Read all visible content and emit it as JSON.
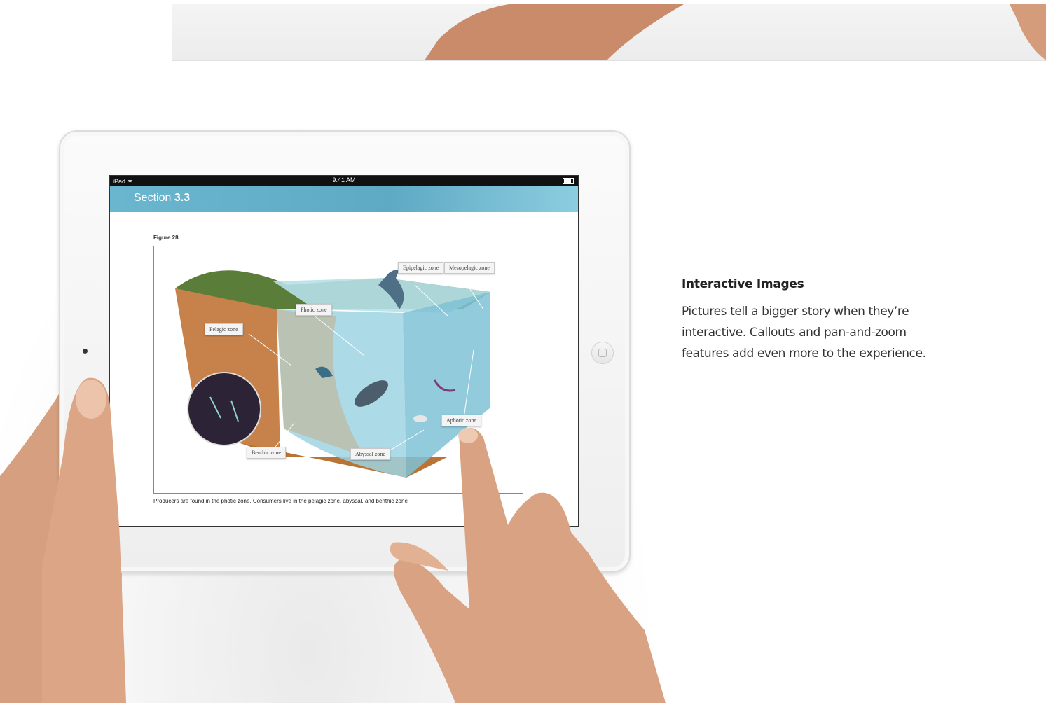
{
  "device": {
    "status_left": "iPad ᯤ",
    "status_time": "9:41 AM"
  },
  "ebook": {
    "section_prefix": "Section",
    "section_number": "3.3",
    "figure_label": "Figure 28",
    "callouts": {
      "epipelagic": "Epipelagic zone",
      "mesopelagic": "Mesopelagic zone",
      "photic": "Photic zone",
      "pelagic": "Pelagic zone",
      "aphotic": "Aphotic zone",
      "benthic": "Benthic zone",
      "abyssal": "Abyssal zone"
    },
    "caption": "Producers are found in the photic zone. Consumers live in the pelagic zone, abyssal, and benthic zone"
  },
  "feature": {
    "title": "Interactive Images",
    "body": "Pictures tell a bigger story when they’re interactive. Callouts and pan-and-zoom features add even more to the experience."
  },
  "colors": {
    "section_bar": "#6bb6cf",
    "ocean": "#8fd0e2",
    "soil": "#c88447",
    "skin": "#d9a383"
  }
}
